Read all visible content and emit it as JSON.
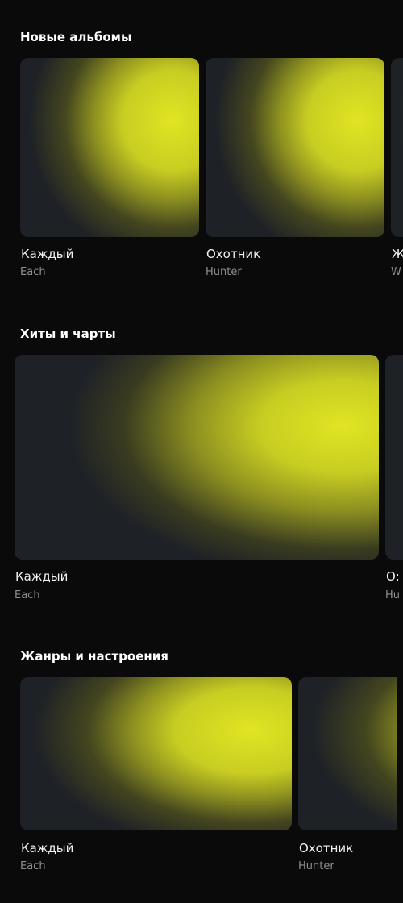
{
  "sections": [
    {
      "title": "Новые альбомы",
      "items": [
        {
          "title": "Каждый",
          "subtitle": "Each"
        },
        {
          "title": "Охотник",
          "subtitle": "Hunter"
        },
        {
          "title": "Ж",
          "subtitle": "W"
        }
      ]
    },
    {
      "title": "Хиты и чарты",
      "items": [
        {
          "title": "Каждый",
          "subtitle": "Each"
        },
        {
          "title": "О:",
          "subtitle": "Hu"
        }
      ]
    },
    {
      "title": "Жанры и настроения",
      "items": [
        {
          "title": "Каждый",
          "subtitle": "Each"
        },
        {
          "title": "Охотник",
          "subtitle": "Hunter"
        }
      ]
    }
  ],
  "colors": {
    "background": "#0a0a0a",
    "accent_yellow": "#e5e81f",
    "cover_dark": "#1e2126"
  }
}
